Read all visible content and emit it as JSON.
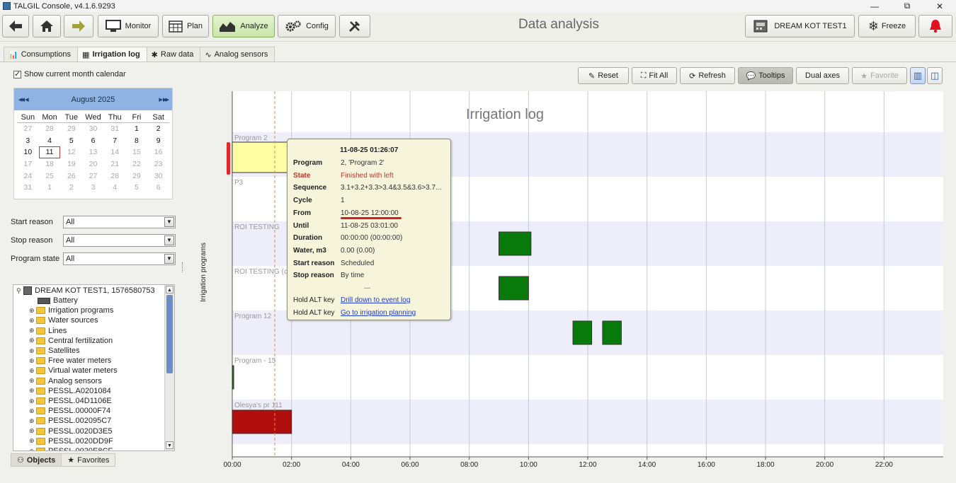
{
  "window": {
    "title": "TALGIL Console, v4.1.6.9293",
    "controls": {
      "minimize": "—",
      "maximize": "⧉",
      "close": "✕"
    }
  },
  "toolbar": {
    "back": "back-arrow-icon",
    "home": "home-icon",
    "forward": "forward-arrow-icon",
    "monitor": "Monitor",
    "plan": "Plan",
    "analyze": "Analyze",
    "config": "Config",
    "page_title": "Data analysis",
    "controller": "DREAM KOT TEST1",
    "freeze": "Freeze"
  },
  "tabs": {
    "consumptions": "Consumptions",
    "irrigation_log": "Irrigation log",
    "raw_data": "Raw data",
    "analog_sensors": "Analog sensors"
  },
  "calendar": {
    "show_label": "Show current month calendar",
    "month": "August 2025",
    "dow": [
      "Sun",
      "Mon",
      "Tue",
      "Wed",
      "Thu",
      "Fri",
      "Sat"
    ],
    "days": [
      {
        "d": "27",
        "m": true
      },
      {
        "d": "28",
        "m": true
      },
      {
        "d": "29",
        "m": true
      },
      {
        "d": "30",
        "m": true
      },
      {
        "d": "31",
        "m": true
      },
      {
        "d": "1",
        "m": false
      },
      {
        "d": "2",
        "m": false
      },
      {
        "d": "3",
        "m": false
      },
      {
        "d": "4",
        "m": false
      },
      {
        "d": "5",
        "m": false
      },
      {
        "d": "6",
        "m": false
      },
      {
        "d": "7",
        "m": false
      },
      {
        "d": "8",
        "m": false
      },
      {
        "d": "9",
        "m": false
      },
      {
        "d": "10",
        "m": false
      },
      {
        "d": "11",
        "m": false,
        "today": true
      },
      {
        "d": "12",
        "m": true
      },
      {
        "d": "13",
        "m": true
      },
      {
        "d": "14",
        "m": true
      },
      {
        "d": "15",
        "m": true
      },
      {
        "d": "16",
        "m": true
      },
      {
        "d": "17",
        "m": true
      },
      {
        "d": "18",
        "m": true
      },
      {
        "d": "19",
        "m": true
      },
      {
        "d": "20",
        "m": true
      },
      {
        "d": "21",
        "m": true
      },
      {
        "d": "22",
        "m": true
      },
      {
        "d": "23",
        "m": true
      },
      {
        "d": "24",
        "m": true
      },
      {
        "d": "25",
        "m": true
      },
      {
        "d": "26",
        "m": true
      },
      {
        "d": "27",
        "m": true
      },
      {
        "d": "28",
        "m": true
      },
      {
        "d": "29",
        "m": true
      },
      {
        "d": "30",
        "m": true
      },
      {
        "d": "31",
        "m": true
      },
      {
        "d": "1",
        "m": true
      },
      {
        "d": "2",
        "m": true
      },
      {
        "d": "3",
        "m": true
      },
      {
        "d": "4",
        "m": true
      },
      {
        "d": "5",
        "m": true
      },
      {
        "d": "6",
        "m": true
      }
    ]
  },
  "filters": {
    "start_reason": {
      "label": "Start reason",
      "value": "All"
    },
    "stop_reason": {
      "label": "Stop reason",
      "value": "All"
    },
    "program_state": {
      "label": "Program state",
      "value": "All"
    }
  },
  "tree": {
    "root": "DREAM KOT TEST1, 1576580753",
    "items": [
      "Battery",
      "Irrigation programs",
      "Water sources",
      "Lines",
      "Central fertilization",
      "Satellites",
      "Free water meters",
      "Virtual water meters",
      "Analog sensors",
      "PESSL.A0201084",
      "PESSL.04D1106E",
      "PESSL.00000F74",
      "PESSL.002095C7",
      "PESSL.0020D3E5",
      "PESSL.0020DD9F",
      "PESSL.0020E8CF"
    ]
  },
  "bottom_tabs": {
    "objects": "Objects",
    "favorites": "Favorites"
  },
  "chart_toolbar": {
    "reset": "Reset",
    "fit_all": "Fit All",
    "refresh": "Refresh",
    "tooltips": "Tooltips",
    "dual_axes": "Dual axes",
    "favorite": "Favorite"
  },
  "chart_data": {
    "type": "gantt",
    "title": "Irrigation log",
    "ylabel": "Irrigation programs",
    "xlim": [
      "00:00",
      "24:00"
    ],
    "x_ticks": [
      "00:00",
      "02:00",
      "04:00",
      "06:00",
      "08:00",
      "10:00",
      "12:00",
      "14:00",
      "16:00",
      "18:00",
      "20:00",
      "22:00"
    ],
    "marker_time": "01:26",
    "rows": [
      {
        "label": "Program 2",
        "bars": [
          {
            "start": "00:00",
            "end": "01:52",
            "color": "#ffffa6"
          }
        ],
        "flag": "#e0282a"
      },
      {
        "label": "P3",
        "bars": []
      },
      {
        "label": "ROI TESTING",
        "bars": [
          {
            "start": "09:00",
            "end": "10:05",
            "color": "#087a0b"
          }
        ]
      },
      {
        "label": "ROI TESTING (c",
        "bars": [
          {
            "start": "09:00",
            "end": "10:00",
            "color": "#087a0b"
          }
        ]
      },
      {
        "label": "Program 12",
        "bars": [
          {
            "start": "11:30",
            "end": "12:08",
            "color": "#087a0b"
          },
          {
            "start": "12:30",
            "end": "13:08",
            "color": "#087a0b"
          }
        ]
      },
      {
        "label": "Program - 15",
        "bars": [
          {
            "start": "00:00",
            "end": "00:02",
            "color": "#087a0b"
          }
        ]
      },
      {
        "label": "Olesya's pr 111",
        "bars": [
          {
            "start": "00:00",
            "end": "02:00",
            "color": "#b00d0d"
          }
        ]
      }
    ]
  },
  "tooltip": {
    "timestamp": "11-08-25 01:26:07",
    "rows": [
      {
        "k": "Program",
        "v": "2, 'Program 2'"
      },
      {
        "k": "State",
        "v": "Finished with left",
        "red": true
      },
      {
        "k": "Sequence",
        "v": "3.1+3.2+3.3>3.4&3.5&3.6>3.7..."
      },
      {
        "k": "Cycle",
        "v": "1"
      },
      {
        "k": "From",
        "v": "10-08-25 12:00:00"
      },
      {
        "k": "Until",
        "v": "11-08-25 03:01:00"
      },
      {
        "k": "Duration",
        "v": "00:00:00 (00:00:00)"
      },
      {
        "k": "Water, m3",
        "v": "0.00 (0.00)"
      },
      {
        "k": "Start reason",
        "v": "Scheduled"
      },
      {
        "k": "Stop reason",
        "v": "By time"
      }
    ],
    "separator": "---",
    "hold1_key": "Hold ALT key",
    "hold1_link": "Drill down to event log",
    "hold2_key": "Hold ALT key",
    "hold2_link": "Go to irrigation planning"
  }
}
